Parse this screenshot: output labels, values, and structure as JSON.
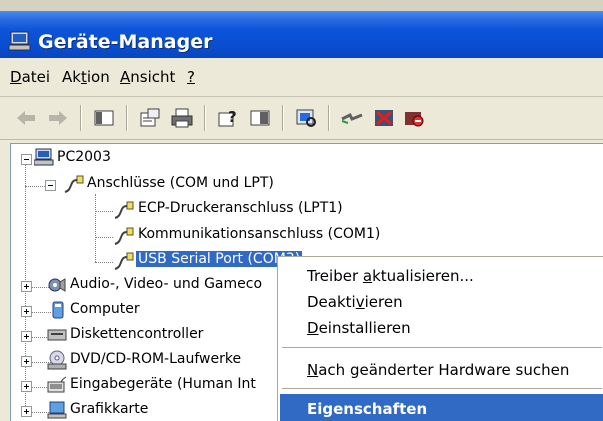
{
  "window": {
    "title": "Geräte-Manager"
  },
  "menu": {
    "file": {
      "pre": "",
      "accel": "D",
      "post": "atei"
    },
    "action": {
      "pre": "Ak",
      "accel": "t",
      "post": "ion"
    },
    "view": {
      "pre": "",
      "accel": "A",
      "post": "nsicht"
    },
    "help": {
      "pre": "",
      "accel": "?",
      "post": ""
    }
  },
  "tree": {
    "root": "PC2003",
    "ports": "Anschlüsse (COM und LPT)",
    "ecp": "ECP-Druckeranschluss (LPT1)",
    "com1": "Kommunikationsanschluss (COM1)",
    "usb": "USB Serial Port (COM3)",
    "audio": "Audio-, Video- und Gameco",
    "computer": "Computer",
    "floppy": "Diskettencontroller",
    "dvd": "DVD/CD-ROM-Laufwerke",
    "input": "Eingabegeräte (Human Int",
    "gpu": "Grafikkarte"
  },
  "context_menu": {
    "update": {
      "pre": "Treiber ",
      "accel": "a",
      "post": "ktualisieren..."
    },
    "disable": {
      "pre": "Deakti",
      "accel": "v",
      "post": "ieren"
    },
    "uninstall": {
      "pre": "",
      "accel": "D",
      "post": "einstallieren"
    },
    "scan": {
      "pre": "",
      "accel": "N",
      "post": "ach geänderter Hardware suchen"
    },
    "properties": "Eigenschaften"
  }
}
